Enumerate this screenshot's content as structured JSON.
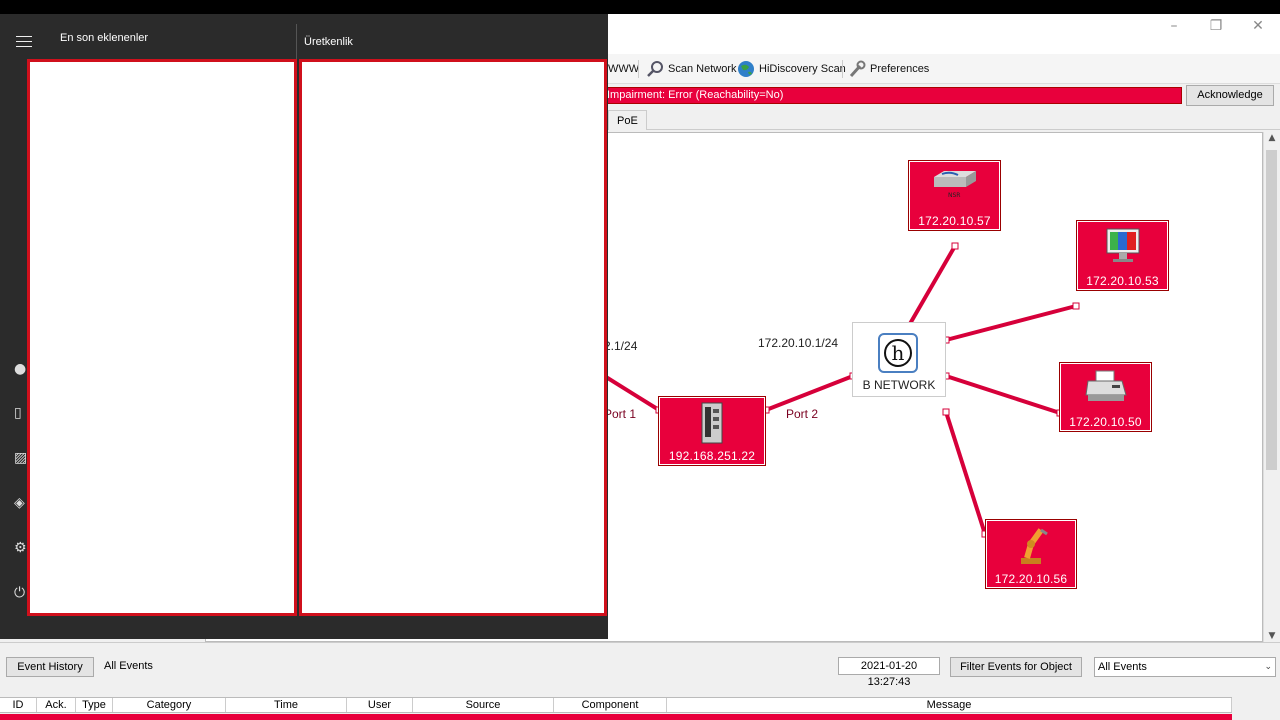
{
  "toolbar": {
    "www_label": "WWW",
    "scan_network": "Scan Network",
    "hidiscovery": "HiDiscovery Scan",
    "preferences": "Preferences"
  },
  "alarm": {
    "message": "Impairment: Error (Reachability=No)",
    "ack_label": "Acknowledge"
  },
  "tabs": [
    {
      "label": "PoE"
    }
  ],
  "canvas": {
    "left_subnet": "2.1/24",
    "subnet": "172.20.10.1/24",
    "hub_label": "B NETWORK",
    "port1": "Port 1",
    "port2": "Port 2",
    "nodes": [
      {
        "ip": "172.20.10.57",
        "kind": "switch"
      },
      {
        "ip": "172.20.10.53",
        "kind": "monitor"
      },
      {
        "ip": "172.20.10.50",
        "kind": "printer"
      },
      {
        "ip": "172.20.10.56",
        "kind": "robot-arm"
      },
      {
        "ip": "192.168.251.22",
        "kind": "industrial-switch"
      }
    ]
  },
  "bottom": {
    "event_history": "Event History",
    "all_events": "All Events",
    "timestamp": "2021-01-20 13:27:43",
    "filter_btn": "Filter Events for Object",
    "filter_select": "All Events",
    "columns": [
      "ID",
      "Ack.",
      "Type",
      "Category",
      "Time",
      "User",
      "Source",
      "Component",
      "Message"
    ]
  },
  "start_menu": {
    "recent_heading": "En son eklenenler",
    "productivity_heading": "Üretkenlik"
  },
  "colors": {
    "alarm_red": "#e8003c",
    "start_bg": "#2b2b2b",
    "panel_border": "#d0101c"
  }
}
